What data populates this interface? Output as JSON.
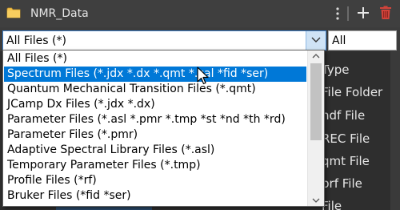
{
  "titlebar": {
    "title": "NMR_Data",
    "folder_icon": "folder-icon",
    "more_icon": "vertical-ellipsis-icon",
    "add_icon": "plus-icon",
    "delete_icon": "trash-icon"
  },
  "filter": {
    "selected": "All Files (*)",
    "arrow_icon": "chevron-down-icon"
  },
  "scope": {
    "selected": "All"
  },
  "dropdown": {
    "items": [
      "All Files (*)",
      "Spectrum Files (*.jdx *.dx *.qmt *.cal *fid *ser)",
      "Quantum Mechanical Transition Files (*.qmt)",
      "JCamp Dx Files (*.jdx *.dx)",
      "Parameter Files (*.asl *.pmr *.tmp *st *nd *th *rd)",
      "Parameter Files (*.pmr)",
      "Adaptive Spectral Library Files (*.asl)",
      "Temporary Parameter Files (*.tmp)",
      "Profile Files (*rf)",
      "Bruker Files (*fid *ser)"
    ],
    "highlighted_index": 1
  },
  "background_list": {
    "types": [
      "Type",
      "File Folder",
      "ndf File",
      "REC File",
      "qmt File",
      "prf File",
      "File"
    ]
  },
  "colors": {
    "titlebar_bg": "#3f3f3f",
    "folder": "#f3c14c",
    "trash": "#d2433a",
    "selection": "#0078d7",
    "arrow_area": "#cfe3f6"
  }
}
